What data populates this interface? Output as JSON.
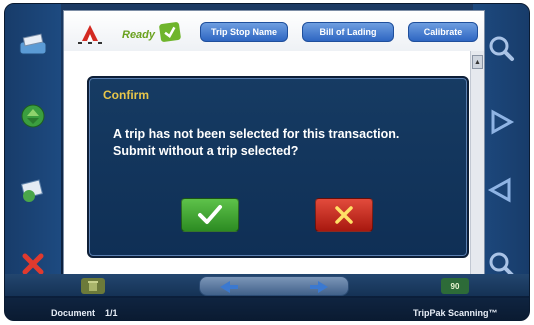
{
  "header": {
    "status_label": "Ready",
    "buttons": [
      {
        "label": "Trip Stop Name"
      },
      {
        "label": "Bill of Lading"
      },
      {
        "label": "Calibrate"
      }
    ]
  },
  "dialog": {
    "title": "Confirm",
    "message": "A trip has not been selected for this transaction. Submit without a trip selected?",
    "confirm_icon": "check-icon",
    "cancel_icon": "x-icon"
  },
  "bottom_bar": {
    "zoom_badge": "90"
  },
  "footer": {
    "document_label": "Document",
    "page_indicator": "1/1",
    "app_name": "TripPak Scanning™"
  },
  "colors": {
    "accent_blue": "#2e66c2",
    "confirm_green": "#2c8b22",
    "cancel_red": "#a8180f",
    "title_gold": "#e8c64a"
  }
}
